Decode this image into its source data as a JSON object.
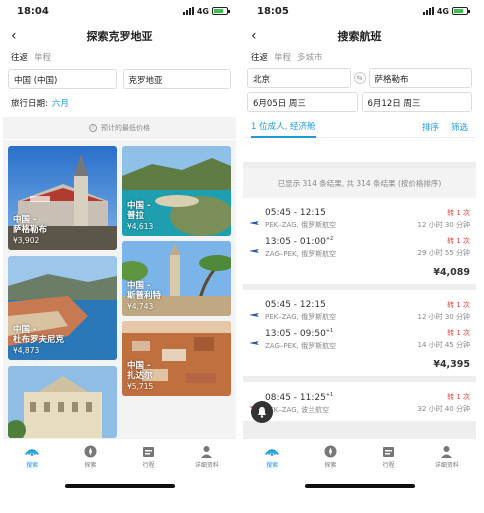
{
  "left": {
    "status": {
      "time": "18:04",
      "network": "4G"
    },
    "nav": {
      "back": "‹",
      "title": "探索克罗地亚"
    },
    "trip_types": [
      "往返",
      "单程"
    ],
    "origin": "中国 (中国)",
    "destination": "克罗地亚",
    "travel_date": {
      "label": "旅行日期:",
      "value": "六月"
    },
    "price_hint": "预计的最低价格",
    "cards": [
      {
        "country": "中国 -",
        "city": "萨格勒布",
        "price": "¥3,902"
      },
      {
        "country": "中国 -",
        "city": "普拉",
        "price": "¥4,613"
      },
      {
        "country": "中国 -",
        "city": "杜布罗夫尼克",
        "price": "¥4,873"
      },
      {
        "country": "中国 -",
        "city": "斯普利特",
        "price": "¥4,743"
      },
      {
        "country": "中国 -",
        "city": "扎达尔",
        "price": "¥5,715"
      }
    ]
  },
  "right": {
    "status": {
      "time": "18:05",
      "network": "4G"
    },
    "nav": {
      "back": "‹",
      "title": "搜索航班"
    },
    "trip_types": [
      "往返",
      "单程",
      "多城市"
    ],
    "origin": "北京",
    "destination": "萨格勒布",
    "depart_date": "6月05日 周三",
    "return_date": "6月12日 周三",
    "passengers": "1 位成人, 经济舱",
    "sort_label": "排序",
    "filter_label": "筛选",
    "summary": "已显示 314 条结果, 共 314 条结果 (按价格排序)",
    "results": [
      {
        "legs": [
          {
            "time": "05:45 - 12:15",
            "sup": "",
            "route": "PEK–ZAG, 俄罗斯航空",
            "stops": "转 1 次",
            "duration": "12 小时 30 分钟"
          },
          {
            "time": "13:05 - 01:00",
            "sup": "+2",
            "route": "ZAG–PEK, 俄罗斯航空",
            "stops": "转 1 次",
            "duration": "29 小时 55 分钟"
          }
        ],
        "price": "¥4,089"
      },
      {
        "legs": [
          {
            "time": "05:45 - 12:15",
            "sup": "",
            "route": "PEK–ZAG, 俄罗斯航空",
            "stops": "转 1 次",
            "duration": "12 小时 30 分钟"
          },
          {
            "time": "13:05 - 09:50",
            "sup": "+1",
            "route": "ZAG–PEK, 俄罗斯航空",
            "stops": "转 1 次",
            "duration": "14 小时 45 分钟"
          }
        ],
        "price": "¥4,395"
      },
      {
        "legs": [
          {
            "time": "08:45 - 11:25",
            "sup": "+1",
            "route": "PEK–ZAG, 波兰航空",
            "stops": "转 1 次",
            "duration": "32 小时 40 分钟"
          }
        ],
        "price": ""
      }
    ]
  },
  "tabbar": [
    "搜索",
    "探索",
    "行程",
    "详细资料"
  ],
  "colors": {
    "accent": "#1a9bd7",
    "stops_red": "#e03c3c"
  }
}
